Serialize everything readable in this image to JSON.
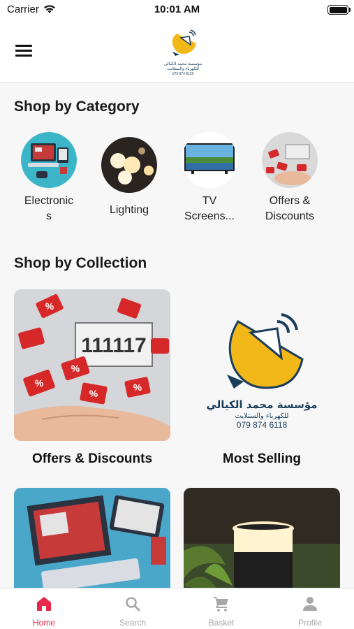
{
  "status_bar": {
    "carrier": "Carrier",
    "time": "10:01 AM"
  },
  "header": {
    "logo": {
      "name_ar": "مؤسسة محمد الكيالي",
      "tagline_ar": "للكهرباء والستلايت",
      "phone": "079 874 6118"
    }
  },
  "categories": {
    "title": "Shop by Category",
    "items": [
      {
        "label_line1": "Electronic",
        "label_line2": "s"
      },
      {
        "label_line1": "Lighting",
        "label_line2": ""
      },
      {
        "label_line1": "TV",
        "label_line2": "Screens..."
      },
      {
        "label_line1": "Offers &",
        "label_line2": "Discounts"
      }
    ]
  },
  "collections": {
    "title": "Shop by Collection",
    "items": [
      {
        "title": "Offers & Discounts",
        "tag_digits": "111117",
        "badge": "%"
      },
      {
        "title": "Most Selling",
        "logo_name_ar": "مؤسسة محمد الكيالي",
        "logo_tagline_ar": "للكهرباء والستلايت",
        "logo_phone": "079 874 6118"
      },
      {
        "title": ""
      },
      {
        "title": ""
      }
    ]
  },
  "tabbar": {
    "tabs": [
      {
        "label": "Home",
        "icon": "home-icon",
        "active": true
      },
      {
        "label": "Search",
        "icon": "search-icon",
        "active": false
      },
      {
        "label": "Basket",
        "icon": "basket-icon",
        "active": false
      },
      {
        "label": "Profile",
        "icon": "profile-icon",
        "active": false
      }
    ]
  },
  "colors": {
    "accent": "#e8284a",
    "inactive": "#a8a8a8",
    "logo_yellow": "#f2b81a",
    "logo_blue": "#1a3d5c"
  }
}
